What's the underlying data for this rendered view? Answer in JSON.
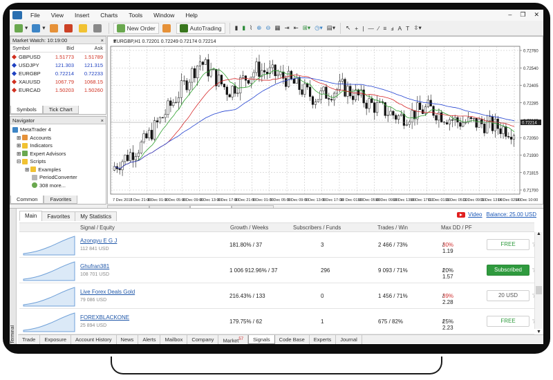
{
  "menu": [
    "File",
    "View",
    "Insert",
    "Charts",
    "Tools",
    "Window",
    "Help"
  ],
  "toolbar": {
    "new_order": "New Order",
    "autotrading": "AutoTrading"
  },
  "market_watch": {
    "title": "Market Watch: 10:19:00",
    "headers": [
      "Symbol",
      "Bid",
      "Ask"
    ],
    "rows": [
      {
        "symbol": "GBPUSD",
        "bid": "1.51773",
        "ask": "1.51789",
        "color": "#d03020"
      },
      {
        "symbol": "USDJPY",
        "bid": "121.303",
        "ask": "121.315",
        "color": "#1e40c0"
      },
      {
        "symbol": "EURGBP",
        "bid": "0.72214",
        "ask": "0.72233",
        "color": "#1e40c0"
      },
      {
        "symbol": "XAUUSD",
        "bid": "1067.79",
        "ask": "1068.15",
        "color": "#d03020"
      },
      {
        "symbol": "EURCAD",
        "bid": "1.50203",
        "ask": "1.50260",
        "color": "#d03020"
      }
    ],
    "tabs": [
      "Symbols",
      "Tick Chart"
    ]
  },
  "navigator": {
    "title": "Navigator",
    "items": [
      "MetaTrader 4",
      "Accounts",
      "Indicators",
      "Expert Advisors",
      "Scripts",
      "Examples",
      "PeriodConverter",
      "308 more..."
    ],
    "tabs": [
      "Common",
      "Favorites"
    ]
  },
  "chart": {
    "header": "EURGBP,H1  0.72201 0.72249 0.72174 0.72214",
    "current_price": "0.72214",
    "price_labels": [
      "0.72760",
      "0.72540",
      "0.72405",
      "0.72285",
      "0.72165",
      "0.72050",
      "0.71930",
      "0.71815",
      "0.71700"
    ],
    "time_labels": [
      "7 Dec 2015",
      "7 Dec 21:00",
      "8 Dec 01:00",
      "8 Dec 05:00",
      "8 Dec 09:00",
      "8 Dec 13:00",
      "8 Dec 17:00",
      "8 Dec 21:00",
      "9 Dec 01:00",
      "9 Dec 05:00",
      "9 Dec 09:00",
      "9 Dec 13:00",
      "9 Dec 17:00",
      "10 Dec 01:00",
      "10 Dec 05:00",
      "10 Dec 09:00",
      "10 Dec 13:00",
      "10 Dec 17:00",
      "11 Dec 01:00",
      "11 Dec 05:00",
      "11 Dec 09:00",
      "11 Dec 13:00",
      "14 Dec 02:00",
      "14 Dec 10:00"
    ],
    "tabs": [
      "GBPUSD,H4",
      "USDJPY,H4",
      "EURGBP,H1",
      "EURCAD,H1"
    ]
  },
  "terminal": {
    "side_label": "Terminal",
    "subtabs": [
      "Main",
      "Favorites",
      "My Statistics"
    ],
    "video": "Video",
    "balance": "Balance: 25.00 USD",
    "headers": [
      "Signal / Equity",
      "Growth / Weeks",
      "Subscribers / Funds",
      "Trades / Win",
      "Max DD / PF"
    ],
    "signals": [
      {
        "name": "Azongyu E G J",
        "equity": "112 841 USD",
        "growth": "181.80% / 37",
        "subs": "3",
        "trades": "2 466 / 73%",
        "dd": "30%",
        "dd_color": "#d03030",
        "pf": "/ 1.19",
        "action": "FREE",
        "action_color": "#2f9a3e",
        "subscribed": false
      },
      {
        "name": "Ghufran381",
        "equity": "108 701 USD",
        "growth": "1 006 912.96% / 37",
        "subs": "296",
        "trades": "9 093 / 71%",
        "dd": "20%",
        "dd_color": "#222",
        "pf": "/ 1.57",
        "action": "Subscribed",
        "action_color": "#fff",
        "subscribed": true
      },
      {
        "name": "Live Forex Deals Gold",
        "equity": "79 086 USD",
        "growth": "216.43% / 133",
        "subs": "0",
        "trades": "1 456 / 71%",
        "dd": "39%",
        "dd_color": "#d03030",
        "pf": "/ 2.28",
        "action": "20 USD",
        "action_color": "#555",
        "subscribed": false
      },
      {
        "name": "FOREXBLACKONE",
        "equity": "25 894 USD",
        "growth": "179.75% / 62",
        "subs": "1",
        "trades": "675 / 82%",
        "dd": "25%",
        "dd_color": "#222",
        "pf": "/ 2.23",
        "action": "FREE",
        "action_color": "#2f9a3e",
        "subscribed": false
      }
    ],
    "bottom_tabs": [
      "Trade",
      "Exposure",
      "Account History",
      "News",
      "Alerts",
      "Mailbox",
      "Company",
      "Market",
      "Signals",
      "Code Base",
      "Experts",
      "Journal"
    ],
    "market_badge": "57",
    "active_tab": "Signals"
  }
}
